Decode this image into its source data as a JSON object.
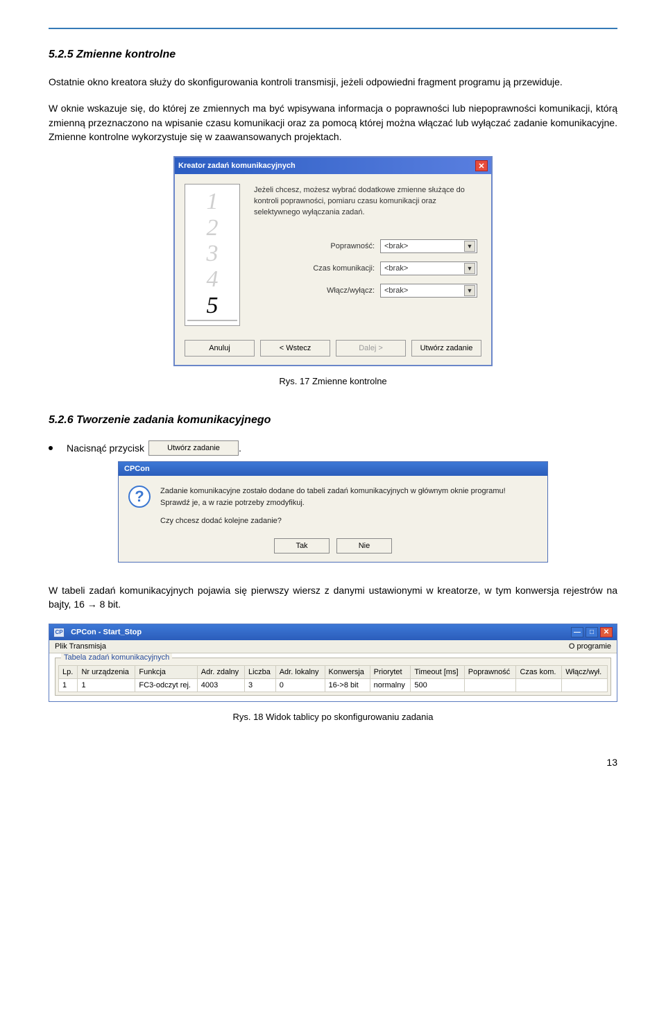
{
  "sec1": {
    "title": "5.2.5 Zmienne kontrolne",
    "p1": "Ostatnie okno kreatora służy do skonfigurowania kontroli transmisji, jeżeli odpowiedni fragment programu ją przewiduje.",
    "p2": "W oknie wskazuje się, do której ze zmiennych ma być wpisywana informacja o poprawności lub niepoprawności komunikacji, którą zmienną przeznaczono na wpisanie czasu komunikacji oraz za pomocą której można włączać lub wyłączać zadanie komunikacyjne. Zmienne kontrolne wykorzystuje się w zaawansowanych projektach."
  },
  "wizard": {
    "title": "Kreator zadań komunikacyjnych",
    "intro": "Jeżeli chcesz, możesz wybrać dodatkowe zmienne służące do kontroli poprawności, pomiaru czasu komunikacji oraz selektywnego wyłączania zadań.",
    "fields": [
      {
        "label": "Poprawność:",
        "value": "<brak>"
      },
      {
        "label": "Czas komunikacji:",
        "value": "<brak>"
      },
      {
        "label": "Włącz/wyłącz:",
        "value": "<brak>"
      }
    ],
    "buttons": {
      "cancel": "Anuluj",
      "back": "< Wstecz",
      "next": "Dalej >",
      "create": "Utwórz zadanie"
    },
    "caption": "Rys. 17  Zmienne kontrolne"
  },
  "sec2": {
    "title": "5.2.6 Tworzenie zadania komunikacyjnego",
    "press_label": "Nacisnąć przycisk",
    "btn_label": "Utwórz zadanie",
    "dot": "."
  },
  "msg": {
    "title": "CPCon",
    "line1": "Zadanie komunikacyjne zostało dodane do tabeli zadań komunikacyjnych w głównym oknie programu!",
    "line2": "Sprawdź je, a w razie potrzeby zmodyfikuj.",
    "line3": "Czy chcesz dodać kolejne zadanie?",
    "yes": "Tak",
    "no": "Nie"
  },
  "p3": "W tabeli zadań komunikacyjnych pojawia się pierwszy wiersz z danymi ustawionymi w kreatorze, w tym konwersja rejestrów na bajty, 16 → 8 bit.",
  "app": {
    "title": "CPCon - Start_Stop",
    "menu_left": "Plik   Transmisja",
    "menu_right": "O programie",
    "group": "Tabela zadań komunikacyjnych",
    "headers": [
      "Lp.",
      "Nr urządzenia",
      "Funkcja",
      "Adr. zdalny",
      "Liczba",
      "Adr. lokalny",
      "Konwersja",
      "Priorytet",
      "Timeout [ms]",
      "Poprawność",
      "Czas kom.",
      "Włącz/wył."
    ],
    "row": [
      "1",
      "1",
      "FC3-odczyt rej.",
      "4003",
      "3",
      "0",
      "16->8 bit",
      "normalny",
      "500",
      "",
      "",
      ""
    ]
  },
  "caption2": "Rys. 18 Widok tablicy po skonfigurowaniu zadania",
  "page": "13"
}
